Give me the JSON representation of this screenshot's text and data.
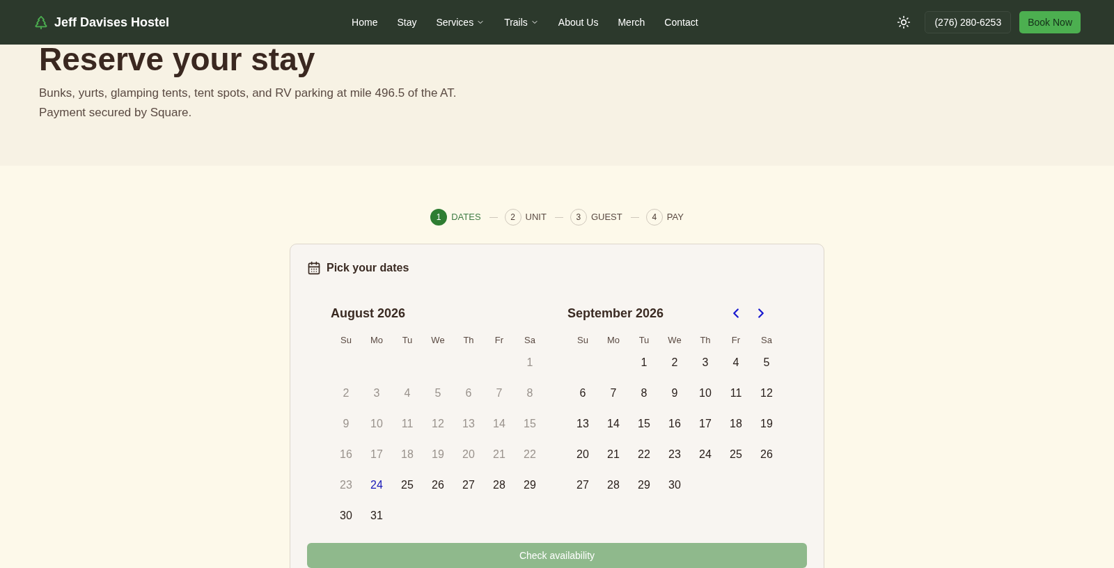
{
  "nav": {
    "brand": "Jeff Davises Hostel",
    "links": [
      {
        "label": "Home",
        "dropdown": false
      },
      {
        "label": "Stay",
        "dropdown": false
      },
      {
        "label": "Services",
        "dropdown": true
      },
      {
        "label": "Trails",
        "dropdown": true
      },
      {
        "label": "About Us",
        "dropdown": false
      },
      {
        "label": "Merch",
        "dropdown": false
      },
      {
        "label": "Contact",
        "dropdown": false
      }
    ],
    "phone": "(276) 280-6253",
    "cta": "Book Now"
  },
  "hero": {
    "title": "Reserve your stay",
    "lines": [
      "Bunks, yurts, glamping tents, tent spots, and RV parking at mile 496.5 of the AT.",
      "Payment secured by Square."
    ]
  },
  "steps": [
    {
      "number": "1",
      "label": "DATES",
      "selected": true
    },
    {
      "number": "2",
      "label": "UNIT",
      "selected": false
    },
    {
      "number": "3",
      "label": "GUEST",
      "selected": false
    },
    {
      "number": "4",
      "label": "PAY",
      "selected": false
    }
  ],
  "card": {
    "title": "Pick your dates",
    "button": "Check availability",
    "button_disabled": true,
    "months": [
      {
        "name": "August 2026",
        "nav": false,
        "weekdays": [
          "Su",
          "Mo",
          "Tu",
          "We",
          "Th",
          "Fr",
          "Sa"
        ],
        "weeks": [
          [
            {
              "kind": "blank"
            },
            {
              "kind": "blank"
            },
            {
              "kind": "blank"
            },
            {
              "kind": "blank"
            },
            {
              "kind": "blank"
            },
            {
              "kind": "blank"
            },
            {
              "kind": "day",
              "label": "1",
              "disabled": true,
              "today": false
            }
          ],
          [
            {
              "kind": "day",
              "label": "2",
              "disabled": true,
              "today": false
            },
            {
              "kind": "day",
              "label": "3",
              "disabled": true,
              "today": false
            },
            {
              "kind": "day",
              "label": "4",
              "disabled": true,
              "today": false
            },
            {
              "kind": "day",
              "label": "5",
              "disabled": true,
              "today": false
            },
            {
              "kind": "day",
              "label": "6",
              "disabled": true,
              "today": false
            },
            {
              "kind": "day",
              "label": "7",
              "disabled": true,
              "today": false
            },
            {
              "kind": "day",
              "label": "8",
              "disabled": true,
              "today": false
            }
          ],
          [
            {
              "kind": "day",
              "label": "9",
              "disabled": true,
              "today": false
            },
            {
              "kind": "day",
              "label": "10",
              "disabled": true,
              "today": false
            },
            {
              "kind": "day",
              "label": "11",
              "disabled": true,
              "today": false
            },
            {
              "kind": "day",
              "label": "12",
              "disabled": true,
              "today": false
            },
            {
              "kind": "day",
              "label": "13",
              "disabled": true,
              "today": false
            },
            {
              "kind": "day",
              "label": "14",
              "disabled": true,
              "today": false
            },
            {
              "kind": "day",
              "label": "15",
              "disabled": true,
              "today": false
            }
          ],
          [
            {
              "kind": "day",
              "label": "16",
              "disabled": true,
              "today": false
            },
            {
              "kind": "day",
              "label": "17",
              "disabled": true,
              "today": false
            },
            {
              "kind": "day",
              "label": "18",
              "disabled": true,
              "today": false
            },
            {
              "kind": "day",
              "label": "19",
              "disabled": true,
              "today": false
            },
            {
              "kind": "day",
              "label": "20",
              "disabled": true,
              "today": false
            },
            {
              "kind": "day",
              "label": "21",
              "disabled": true,
              "today": false
            },
            {
              "kind": "day",
              "label": "22",
              "disabled": true,
              "today": false
            }
          ],
          [
            {
              "kind": "day",
              "label": "23",
              "disabled": true,
              "today": false
            },
            {
              "kind": "day",
              "label": "24",
              "disabled": false,
              "today": true
            },
            {
              "kind": "day",
              "label": "25",
              "disabled": false,
              "today": false
            },
            {
              "kind": "day",
              "label": "26",
              "disabled": false,
              "today": false
            },
            {
              "kind": "day",
              "label": "27",
              "disabled": false,
              "today": false
            },
            {
              "kind": "day",
              "label": "28",
              "disabled": false,
              "today": false
            },
            {
              "kind": "day",
              "label": "29",
              "disabled": false,
              "today": false
            }
          ],
          [
            {
              "kind": "day",
              "label": "30",
              "disabled": false,
              "today": false
            },
            {
              "kind": "day",
              "label": "31",
              "disabled": false,
              "today": false
            }
          ]
        ]
      },
      {
        "name": "September 2026",
        "nav": true,
        "weekdays": [
          "Su",
          "Mo",
          "Tu",
          "We",
          "Th",
          "Fr",
          "Sa"
        ],
        "weeks": [
          [
            {
              "kind": "blank"
            },
            {
              "kind": "blank"
            },
            {
              "kind": "day",
              "label": "1",
              "disabled": false,
              "today": false
            },
            {
              "kind": "day",
              "label": "2",
              "disabled": false,
              "today": false
            },
            {
              "kind": "day",
              "label": "3",
              "disabled": false,
              "today": false
            },
            {
              "kind": "day",
              "label": "4",
              "disabled": false,
              "today": false
            },
            {
              "kind": "day",
              "label": "5",
              "disabled": false,
              "today": false
            }
          ],
          [
            {
              "kind": "day",
              "label": "6",
              "disabled": false,
              "today": false
            },
            {
              "kind": "day",
              "label": "7",
              "disabled": false,
              "today": false
            },
            {
              "kind": "day",
              "label": "8",
              "disabled": false,
              "today": false
            },
            {
              "kind": "day",
              "label": "9",
              "disabled": false,
              "today": false
            },
            {
              "kind": "day",
              "label": "10",
              "disabled": false,
              "today": false
            },
            {
              "kind": "day",
              "label": "11",
              "disabled": false,
              "today": false
            },
            {
              "kind": "day",
              "label": "12",
              "disabled": false,
              "today": false
            }
          ],
          [
            {
              "kind": "day",
              "label": "13",
              "disabled": false,
              "today": false
            },
            {
              "kind": "day",
              "label": "14",
              "disabled": false,
              "today": false
            },
            {
              "kind": "day",
              "label": "15",
              "disabled": false,
              "today": false
            },
            {
              "kind": "day",
              "label": "16",
              "disabled": false,
              "today": false
            },
            {
              "kind": "day",
              "label": "17",
              "disabled": false,
              "today": false
            },
            {
              "kind": "day",
              "label": "18",
              "disabled": false,
              "today": false
            },
            {
              "kind": "day",
              "label": "19",
              "disabled": false,
              "today": false
            }
          ],
          [
            {
              "kind": "day",
              "label": "20",
              "disabled": false,
              "today": false
            },
            {
              "kind": "day",
              "label": "21",
              "disabled": false,
              "today": false
            },
            {
              "kind": "day",
              "label": "22",
              "disabled": false,
              "today": false
            },
            {
              "kind": "day",
              "label": "23",
              "disabled": false,
              "today": false
            },
            {
              "kind": "day",
              "label": "24",
              "disabled": false,
              "today": false
            },
            {
              "kind": "day",
              "label": "25",
              "disabled": false,
              "today": false
            },
            {
              "kind": "day",
              "label": "26",
              "disabled": false,
              "today": false
            }
          ],
          [
            {
              "kind": "day",
              "label": "27",
              "disabled": false,
              "today": false
            },
            {
              "kind": "day",
              "label": "28",
              "disabled": false,
              "today": false
            },
            {
              "kind": "day",
              "label": "29",
              "disabled": false,
              "today": false
            },
            {
              "kind": "day",
              "label": "30",
              "disabled": false,
              "today": false
            }
          ]
        ]
      }
    ]
  }
}
